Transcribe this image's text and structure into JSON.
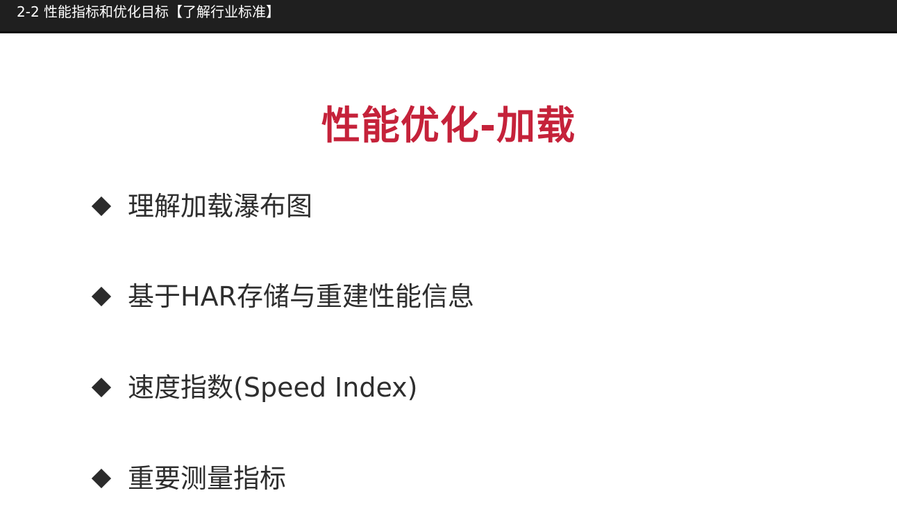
{
  "window": {
    "title": "2-2 性能指标和优化目标【了解行业标准】"
  },
  "slide": {
    "heading": "性能优化-加载",
    "bullets": [
      {
        "icon": "diamond-bullet-icon",
        "label": "理解加载瀑布图"
      },
      {
        "icon": "diamond-bullet-icon",
        "label": "基于HAR存储与重建性能信息"
      },
      {
        "icon": "diamond-bullet-icon",
        "label": "速度指数(Speed Index)"
      },
      {
        "icon": "diamond-bullet-icon",
        "label": "重要测量指标"
      }
    ]
  },
  "colors": {
    "title_bar_bg": "#1f1f1f",
    "heading": "#c5223a",
    "body_text": "#2e2e2e",
    "background": "#ffffff"
  }
}
